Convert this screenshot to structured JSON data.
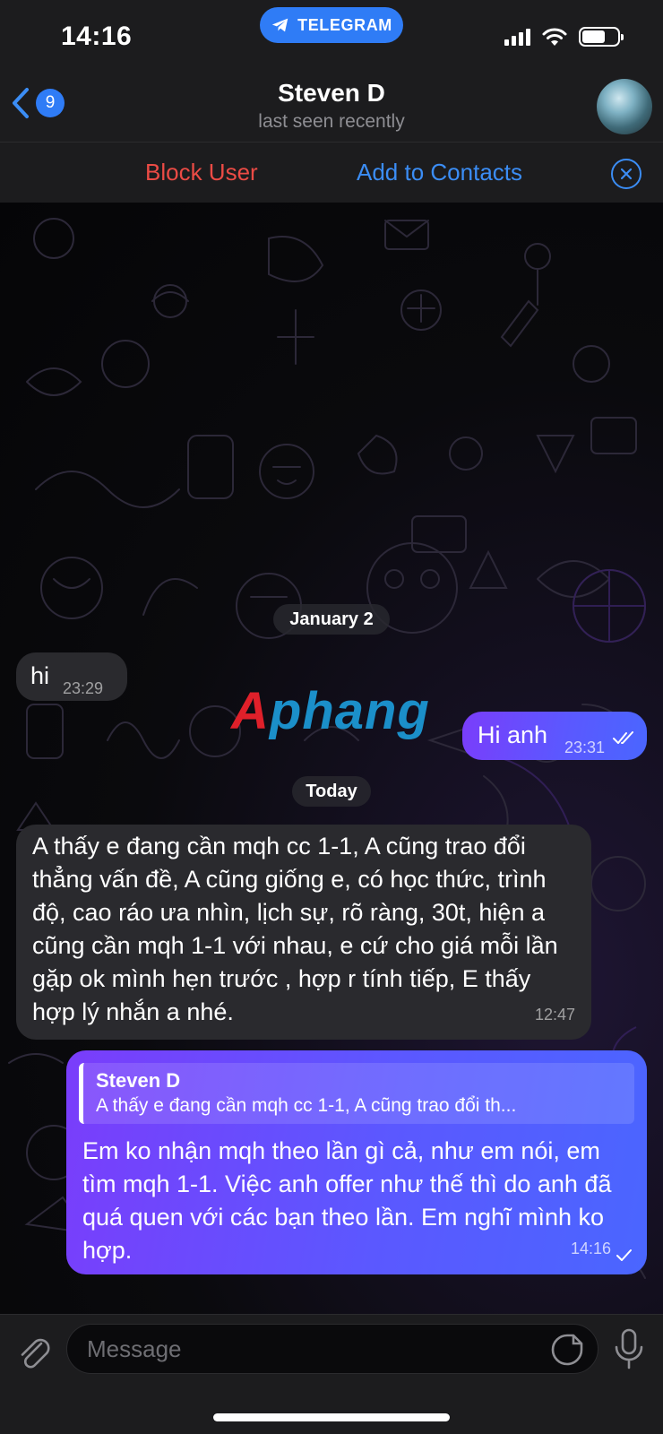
{
  "status_bar": {
    "time": "14:16",
    "app_pill": "TELEGRAM",
    "icons": [
      "signal-icon",
      "wifi-icon",
      "battery-icon"
    ]
  },
  "header": {
    "back_badge": "9",
    "title": "Steven D",
    "subtitle": "last seen recently",
    "avatar_icon": "avatar"
  },
  "actions": {
    "block": "Block User",
    "add": "Add to Contacts"
  },
  "watermark": {
    "part1": "A",
    "part2": "phang"
  },
  "chat": {
    "dates": [
      "January 2",
      "Today"
    ],
    "messages": [
      {
        "direction": "in",
        "text": "hi",
        "time": "23:29"
      },
      {
        "direction": "out",
        "text": "Hi anh",
        "time": "23:31",
        "status": "read"
      },
      {
        "direction": "in",
        "text": "A thấy e đang cần mqh cc 1-1, A cũng trao đổi thẳng vấn đề, A cũng giống e, có học thức, trình độ, cao ráo ưa nhìn, lịch sự, rõ ràng, 30t, hiện a cũng cần mqh 1-1 với nhau, e cứ cho giá mỗi lần gặp ok mình hẹn trước , hợp r tính tiếp, E thấy hợp lý nhắn a nhé.",
        "time": "12:47"
      },
      {
        "direction": "out",
        "reply_to": {
          "author": "Steven D",
          "text": "A thấy e đang cần mqh cc 1-1, A cũng trao đổi th..."
        },
        "text": "Em ko nhận mqh theo lần gì cả, như em nói, em tìm mqh 1-1. Việc anh offer như thế thì do anh đã quá quen với các bạn theo lần. Em nghĩ mình ko hợp.",
        "time": "14:16",
        "status": "sent"
      }
    ]
  },
  "composer": {
    "placeholder": "Message"
  },
  "colors": {
    "accent": "#3b8df5",
    "danger": "#eb4b45",
    "outgoing_start": "#7a3dfb",
    "outgoing_end": "#4a66ff",
    "incoming": "#2a2a2e"
  }
}
